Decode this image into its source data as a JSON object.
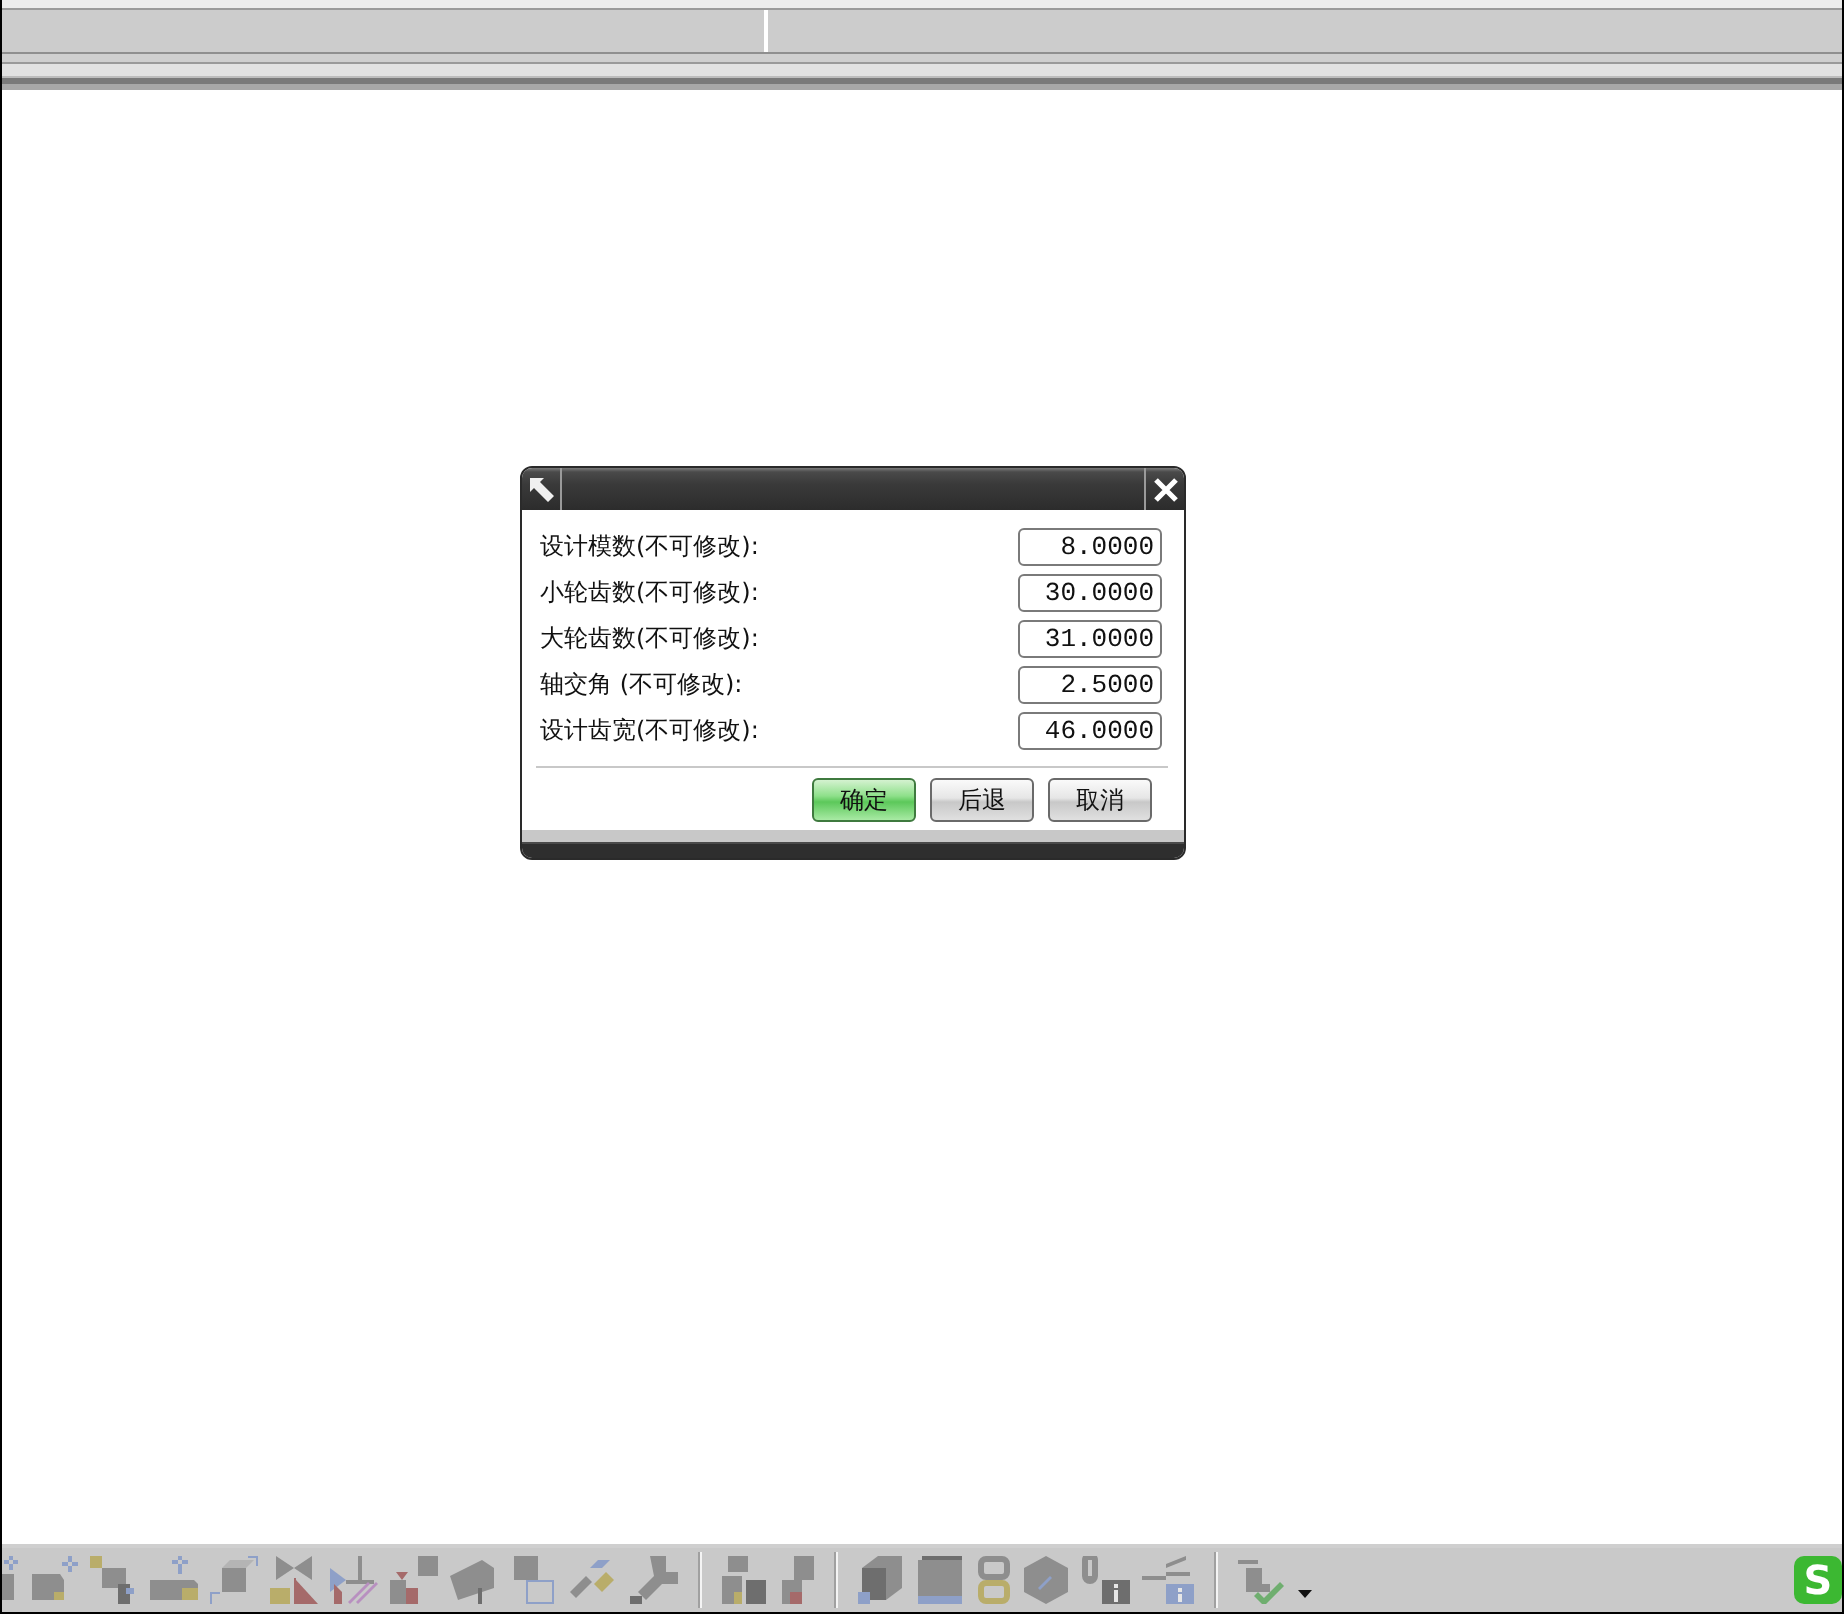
{
  "dialog": {
    "fields": [
      {
        "label": "设计模数(不可修改):",
        "value": "8.0000"
      },
      {
        "label": "小轮齿数(不可修改):",
        "value": "30.0000"
      },
      {
        "label": "大轮齿数(不可修改):",
        "value": "31.0000"
      },
      {
        "label": "轴交角 (不可修改):",
        "value": "2.5000"
      },
      {
        "label": "设计齿宽(不可修改):",
        "value": "46.0000"
      }
    ],
    "buttons": [
      {
        "label": "确定",
        "default": true
      },
      {
        "label": "后退",
        "default": false
      },
      {
        "label": "取消",
        "default": false
      }
    ]
  },
  "tray": {
    "ime_logo": "S"
  }
}
